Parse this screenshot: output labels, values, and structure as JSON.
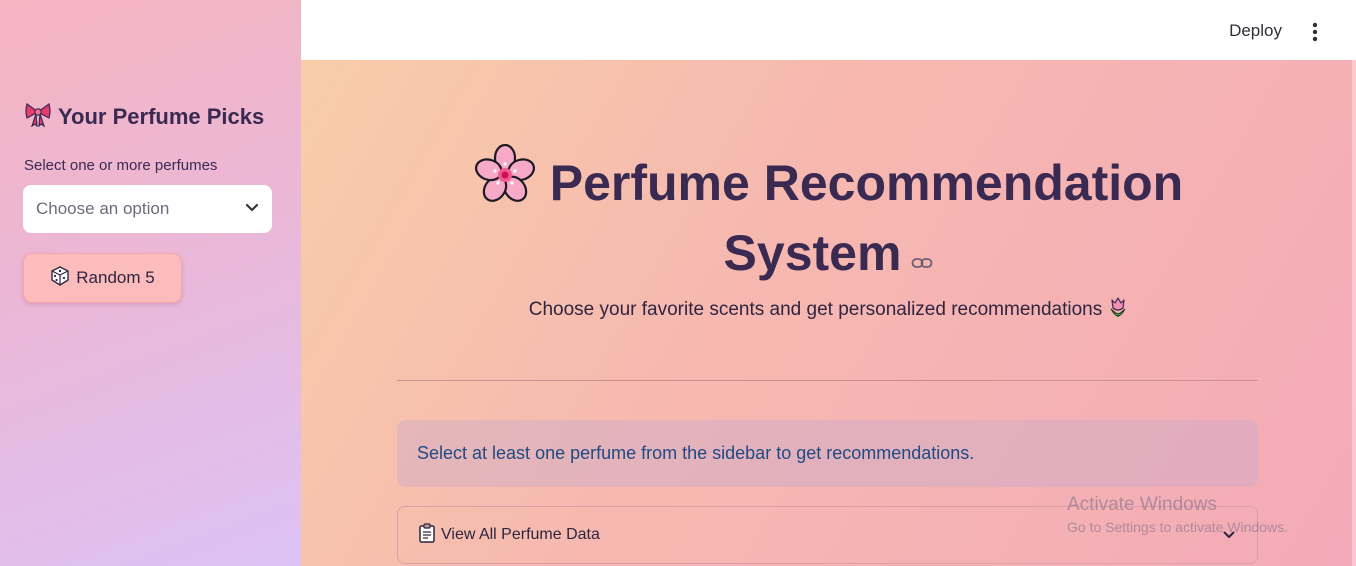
{
  "sidebar": {
    "title_icon": "ribbon-icon",
    "title": "Your Perfume Picks",
    "select_label": "Select one or more perfumes",
    "select_placeholder": "Choose an option",
    "random_button_icon": "dice-icon",
    "random_button_label": "Random 5"
  },
  "topbar": {
    "deploy_label": "Deploy",
    "menu_icon": "kebab-menu-icon"
  },
  "main": {
    "title_icon": "cherry-blossom-icon",
    "title_line1": "Perfume Recommendation",
    "title_line2": "System",
    "anchor_icon": "link-icon",
    "subtitle": "Choose your favorite scents and get personalized recommendations",
    "subtitle_icon": "tulip-icon",
    "info_message": "Select at least one perfume from the sidebar to get recommendations.",
    "expander_icon": "clipboard-icon",
    "expander_label": "View All Perfume Data"
  },
  "watermark": {
    "line1": "Activate Windows",
    "line2": "Go to Settings to activate Windows."
  },
  "colors": {
    "title_text": "#3a2a52",
    "info_text": "#1f4a82",
    "random_button_bg": "#fcbcbc"
  }
}
